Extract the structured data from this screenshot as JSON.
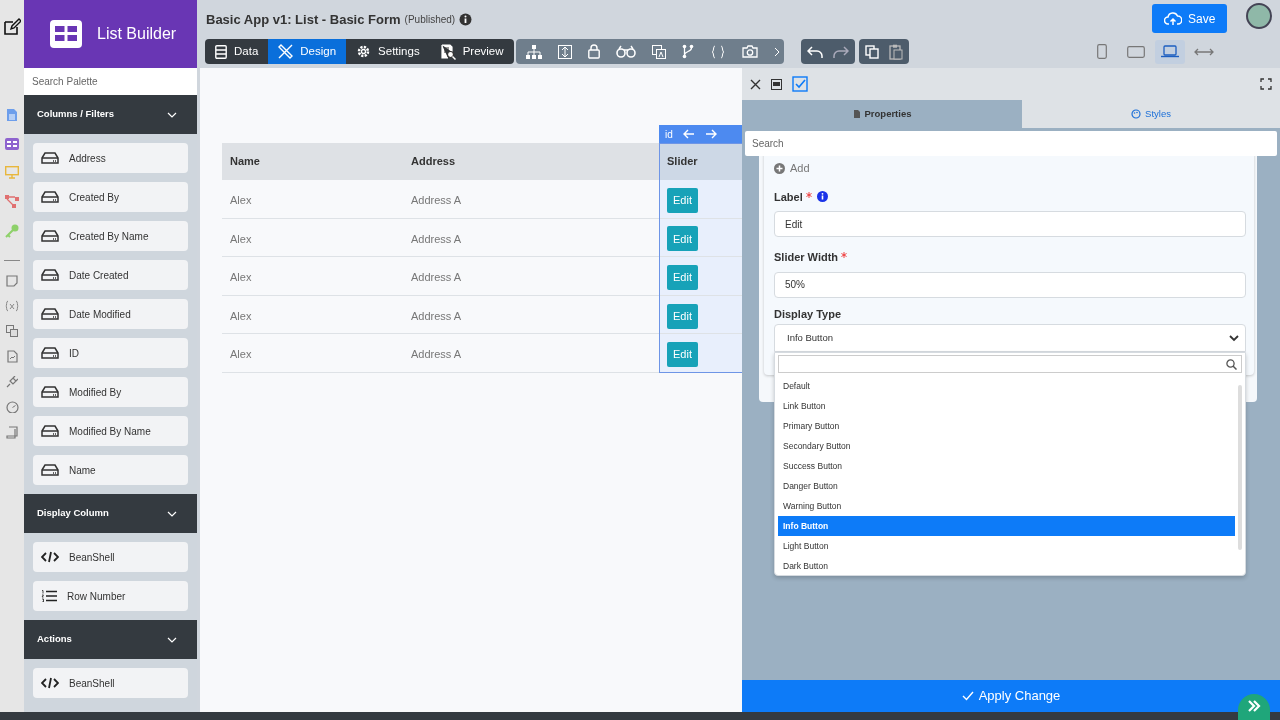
{
  "builder": {
    "title": "List Builder"
  },
  "form_title": {
    "title": "Basic App v1: List - Basic Form",
    "status": "(Published)"
  },
  "mode_tabs": [
    {
      "label": "Data",
      "kind": "data",
      "selected": false
    },
    {
      "label": "Design",
      "kind": "design",
      "selected": true
    },
    {
      "label": "Settings",
      "kind": "settings",
      "selected": false
    },
    {
      "label": "Preview",
      "kind": "preview",
      "selected": false
    }
  ],
  "device_views": [
    {
      "kind": "phone",
      "selected": false
    },
    {
      "kind": "tablet",
      "selected": false
    },
    {
      "kind": "laptop",
      "selected": true
    },
    {
      "kind": "fit",
      "selected": false
    }
  ],
  "save_button": "Save",
  "palette": {
    "search_placeholder": "Search Palette",
    "sections": [
      {
        "title": "Columns / Filters",
        "items": [
          {
            "label": "Address",
            "kind": "column"
          },
          {
            "label": "Created By",
            "kind": "column"
          },
          {
            "label": "Created By Name",
            "kind": "column"
          },
          {
            "label": "Date Created",
            "kind": "column"
          },
          {
            "label": "Date Modified",
            "kind": "column"
          },
          {
            "label": "ID",
            "kind": "column"
          },
          {
            "label": "Modified By",
            "kind": "column"
          },
          {
            "label": "Modified By Name",
            "kind": "column"
          },
          {
            "label": "Name",
            "kind": "column"
          }
        ]
      },
      {
        "title": "Display Column",
        "items": [
          {
            "label": "BeanShell",
            "kind": "code"
          },
          {
            "label": "Row Number",
            "kind": "numbered"
          }
        ]
      },
      {
        "title": "Actions",
        "items": [
          {
            "label": "BeanShell",
            "kind": "code"
          }
        ]
      }
    ]
  },
  "table": {
    "columns": [
      "Name",
      "Address",
      "Slider"
    ],
    "selected_column_tag": "id",
    "rows": [
      {
        "cells": [
          "Alex",
          "Address A",
          "Edit"
        ]
      },
      {
        "cells": [
          "Alex",
          "Address A",
          "Edit"
        ]
      },
      {
        "cells": [
          "Alex",
          "Address A",
          "Edit"
        ]
      },
      {
        "cells": [
          "Alex",
          "Address A",
          "Edit"
        ]
      },
      {
        "cells": [
          "Alex",
          "Address A",
          "Edit"
        ]
      }
    ]
  },
  "properties_panel": {
    "tabs": [
      {
        "label": "Properties",
        "selected": true
      },
      {
        "label": "Styles",
        "selected": false
      }
    ],
    "search_placeholder": "Search",
    "add_label": "Add",
    "fields": [
      {
        "label": "Label",
        "required": true,
        "info": true,
        "value": "Edit"
      },
      {
        "label": "Slider Width",
        "required": true,
        "info": false,
        "value": "50%"
      }
    ],
    "display_type": {
      "label": "Display Type",
      "value": "Info Button",
      "options": [
        {
          "label": "Default",
          "selected": false
        },
        {
          "label": "Link Button",
          "selected": false
        },
        {
          "label": "Primary Button",
          "selected": false
        },
        {
          "label": "Secondary Button",
          "selected": false
        },
        {
          "label": "Success Button",
          "selected": false
        },
        {
          "label": "Danger Button",
          "selected": false
        },
        {
          "label": "Warning Button",
          "selected": false
        },
        {
          "label": "Info Button",
          "selected": true
        },
        {
          "label": "Light Button",
          "selected": false
        },
        {
          "label": "Dark Button",
          "selected": false
        }
      ]
    },
    "apply_button": "Apply Change"
  }
}
